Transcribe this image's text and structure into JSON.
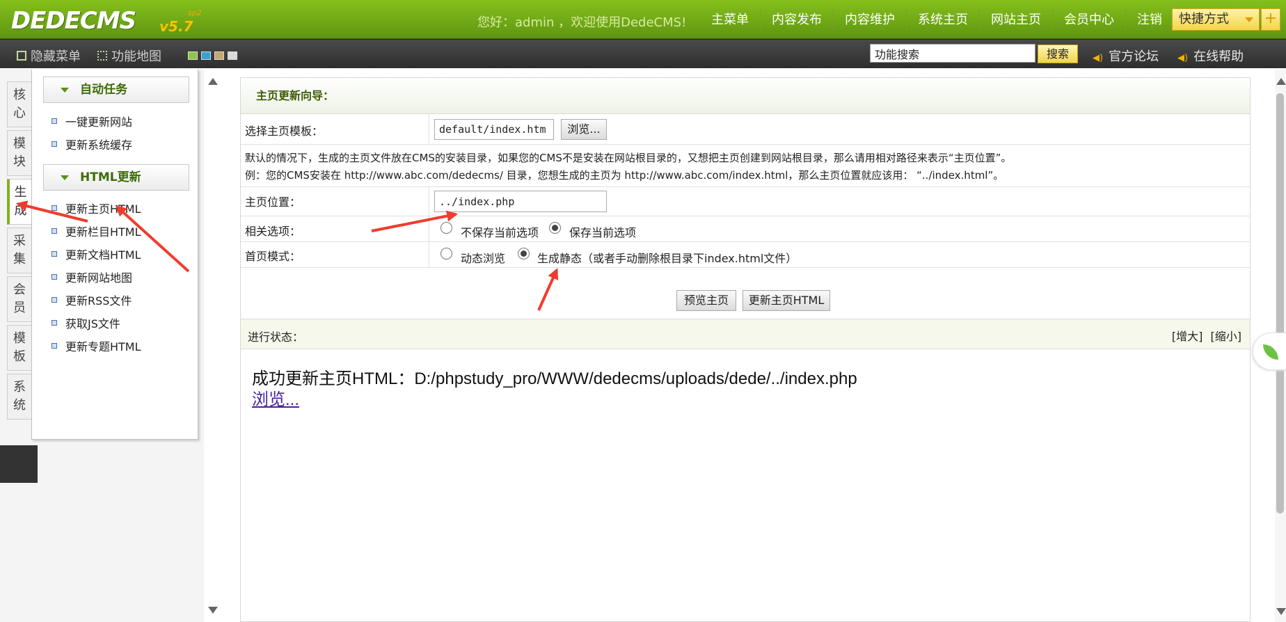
{
  "topbar": {
    "logo_name": "DEDECMS",
    "logo_version": "v5.7",
    "logo_subversion": "sp2",
    "welcome": "您好：admin ，欢迎使用DedeCMS!",
    "nav": [
      "主菜单",
      "内容发布",
      "内容维护",
      "系统主页",
      "网站主页",
      "会员中心",
      "注销"
    ],
    "quick_label": "快捷方式",
    "plus_label": "+"
  },
  "subbar": {
    "hide_menu": "隐藏菜单",
    "function_map": "功能地图",
    "skins": [
      "#8dc63f",
      "#3aa0d8",
      "#c8a86a",
      "#d9d9d9"
    ],
    "search_value": "功能搜索",
    "search_button": "搜索",
    "forum": "官方论坛",
    "help": "在线帮助"
  },
  "vtabs": [
    "核心",
    "模块",
    "生成",
    "采集",
    "会员",
    "模板",
    "系统"
  ],
  "menu": {
    "sections": [
      {
        "title": "自动任务",
        "items": [
          "一键更新网站",
          "更新系统缓存"
        ]
      },
      {
        "title": "HTML更新",
        "items": [
          "更新主页HTML",
          "更新栏目HTML",
          "更新文档HTML",
          "更新网站地图",
          "更新RSS文件",
          "获取JS文件",
          "更新专题HTML"
        ]
      }
    ]
  },
  "main": {
    "wizard_title": "主页更新向导：",
    "template_label": "选择主页模板：",
    "template_value": "default/index.htm",
    "browse_button": "浏览...",
    "info_line1": "默认的情况下，生成的主页文件放在CMS的安装目录，如果您的CMS不是安装在网站根目录的，又想把主页创建到网站根目录，那么请用相对路径来表示“主页位置”。",
    "info_line2": "例：您的CMS安装在 http://www.abc.com/dedecms/ 目录，您想生成的主页为 http://www.abc.com/index.html，那么主页位置就应该用： “../index.html”。",
    "position_label": "主页位置：",
    "position_value": "../index.php",
    "options_label": "相关选项：",
    "option_not_save": "不保存当前选项",
    "option_save": "保存当前选项",
    "mode_label": "首页模式：",
    "mode_dynamic": "动态浏览",
    "mode_static": "生成静态（或者手动删除根目录下index.html文件）",
    "preview_button": "预览主页",
    "update_button": "更新主页HTML",
    "status_label": "进行状态：",
    "enlarge": "[增大]",
    "shrink": "[缩小]",
    "result_text": "成功更新主页HTML：D:/phpstudy_pro/WWW/dedecms/uploads/dede/../index.php",
    "result_link": "浏览..."
  },
  "colors": {
    "brand_green": "#6fa81a",
    "annotation_red": "#f03c2e"
  }
}
